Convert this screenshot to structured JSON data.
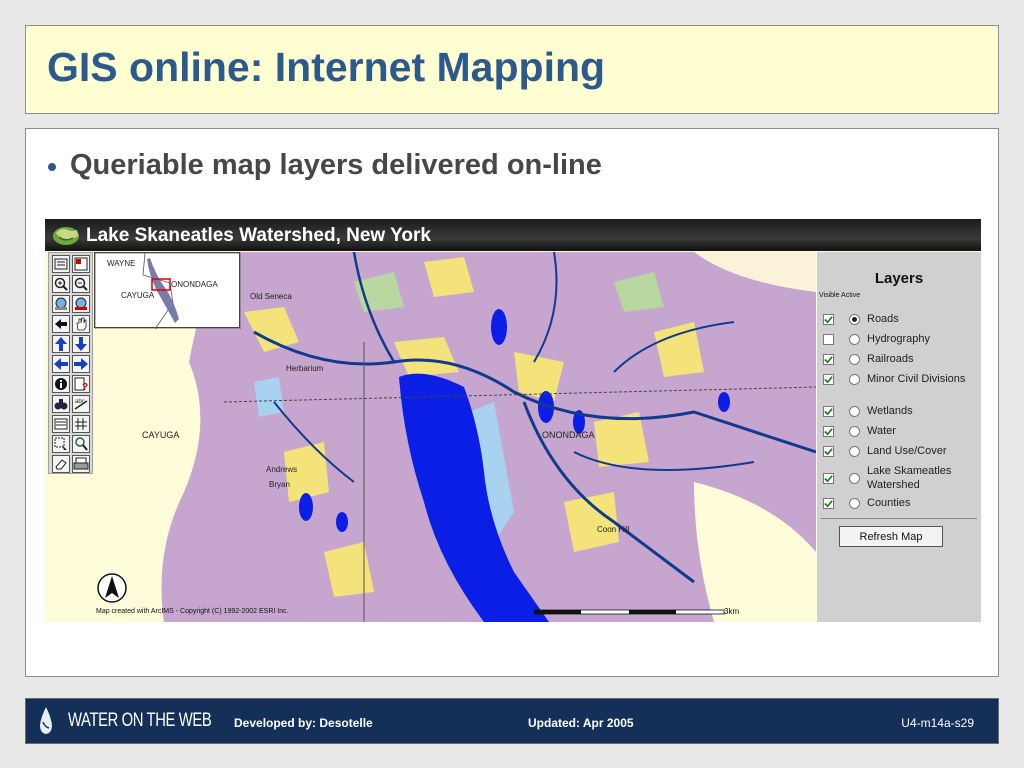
{
  "slide": {
    "title": "GIS online: Internet Mapping",
    "bullet": "Queriable map layers delivered on-line"
  },
  "app": {
    "title": "Lake Skaneatles Watershed, New York",
    "toolbar_icons": [
      "legend-icon",
      "layer-list-icon",
      "zoom-in-icon",
      "zoom-out-icon",
      "zoom-full-icon",
      "zoom-active-icon",
      "back-extent-icon",
      "pan-icon",
      "pan-north-icon",
      "pan-south-icon",
      "pan-west-icon",
      "pan-east-icon",
      "identify-icon",
      "query-icon",
      "find-icon",
      "measure-icon",
      "select-icon",
      "buffer-icon",
      "select-rectangle-icon",
      "select-by-line-icon",
      "clear-selection-icon",
      "print-icon"
    ],
    "overview": {
      "labels": [
        "WAYNE",
        "ONONDAGA",
        "CAYUGA"
      ]
    },
    "map": {
      "labels": [
        "Old Seneca",
        "Herbarium",
        "CAYUGA",
        "ONONDAGA",
        "Andrews",
        "Bryan",
        "Coon Hill"
      ],
      "copyright": "Map created with ArcIMS - Copyright (C) 1992-2002 ESRI Inc.",
      "scale_label": "3km"
    },
    "layers_panel": {
      "title": "Layers",
      "subtitle": "Visible Active",
      "layers": [
        {
          "name": "Roads",
          "visible": true,
          "active": true
        },
        {
          "name": "Hydrography",
          "visible": false,
          "active": false
        },
        {
          "name": "Railroads",
          "visible": true,
          "active": false
        },
        {
          "name": "Minor Civil Divisions",
          "visible": true,
          "active": false
        },
        {
          "name": "Wetlands",
          "visible": true,
          "active": false
        },
        {
          "name": "Water",
          "visible": true,
          "active": false
        },
        {
          "name": "Land Use/Cover",
          "visible": true,
          "active": false
        },
        {
          "name": "Lake Skameatles Watershed",
          "visible": true,
          "active": false
        },
        {
          "name": "Counties",
          "visible": true,
          "active": false
        }
      ],
      "refresh_label": "Refresh Map"
    }
  },
  "footer": {
    "logo_text": "WATER ON THE WEB",
    "developed_by": "Developed by:  Desotelle",
    "updated": "Updated: Apr 2005",
    "slide_id": "U4-m14a-s29"
  },
  "colors": {
    "title_bg": "#ffffd2",
    "title_text": "#2c5a8c",
    "footer_bg": "#143059",
    "lake": "#0a1ee6",
    "land_use_purple": "#c6a6cf",
    "map_background": "#fffcd9"
  }
}
